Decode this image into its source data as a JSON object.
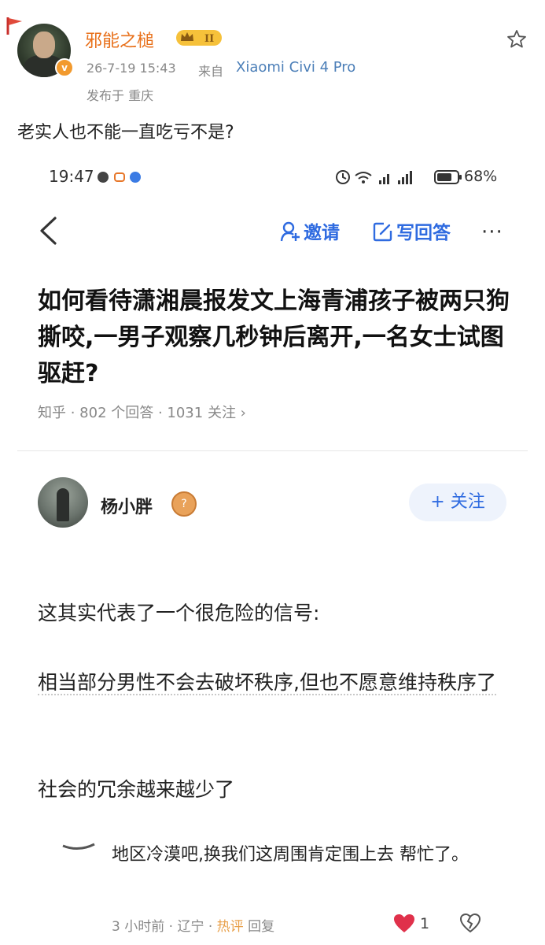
{
  "post": {
    "username": "邪能之槌",
    "vip_level": "II",
    "verified_mark": "v",
    "time": "26-7-19 15:43",
    "source_prefix": "来自",
    "device": "Xiaomi Civi 4 Pro",
    "location": "发布于 重庆",
    "text": "老实人也不能一直吃亏不是?",
    "icons": [
      "favorite-star-icon",
      "verified-badge-icon",
      "vip-crown-icon"
    ]
  },
  "screenshot": {
    "status_bar": {
      "time": "19:47",
      "right": "5G.ıll 5G.ıll 68%",
      "battery": "68%"
    },
    "topbar": {
      "invite": "邀请",
      "write_answer": "写回答",
      "more": "···"
    },
    "question": {
      "title": "如何看待潇湘晨报发文上海青浦孩子被两只狗撕咬,一男子观察几秒钟后离开,一名女士试图驱赶?",
      "meta": "知乎 · 802 个回答 · 1031 关注 ›"
    },
    "answer": {
      "author": "杨小胖",
      "follow": "+ 关注",
      "paragraphs": [
        "这其实代表了一个很危险的信号:",
        "相当部分男性不会去破坏秩序,但也不愿意维持秩序了",
        "社会的冗余越来越少了"
      ]
    },
    "comment": {
      "text": "地区冷漠吧,换我们这周围肯定围上去 帮忙了。",
      "meta_time": "3 小时前",
      "meta_loc": "辽宁",
      "meta_hot": "热评",
      "meta_reply": "回复",
      "likes": "1"
    }
  },
  "colors": {
    "username": "#e8701a",
    "link": "#2f6be0",
    "device": "#4c7fb8",
    "like": "#e0314b"
  }
}
